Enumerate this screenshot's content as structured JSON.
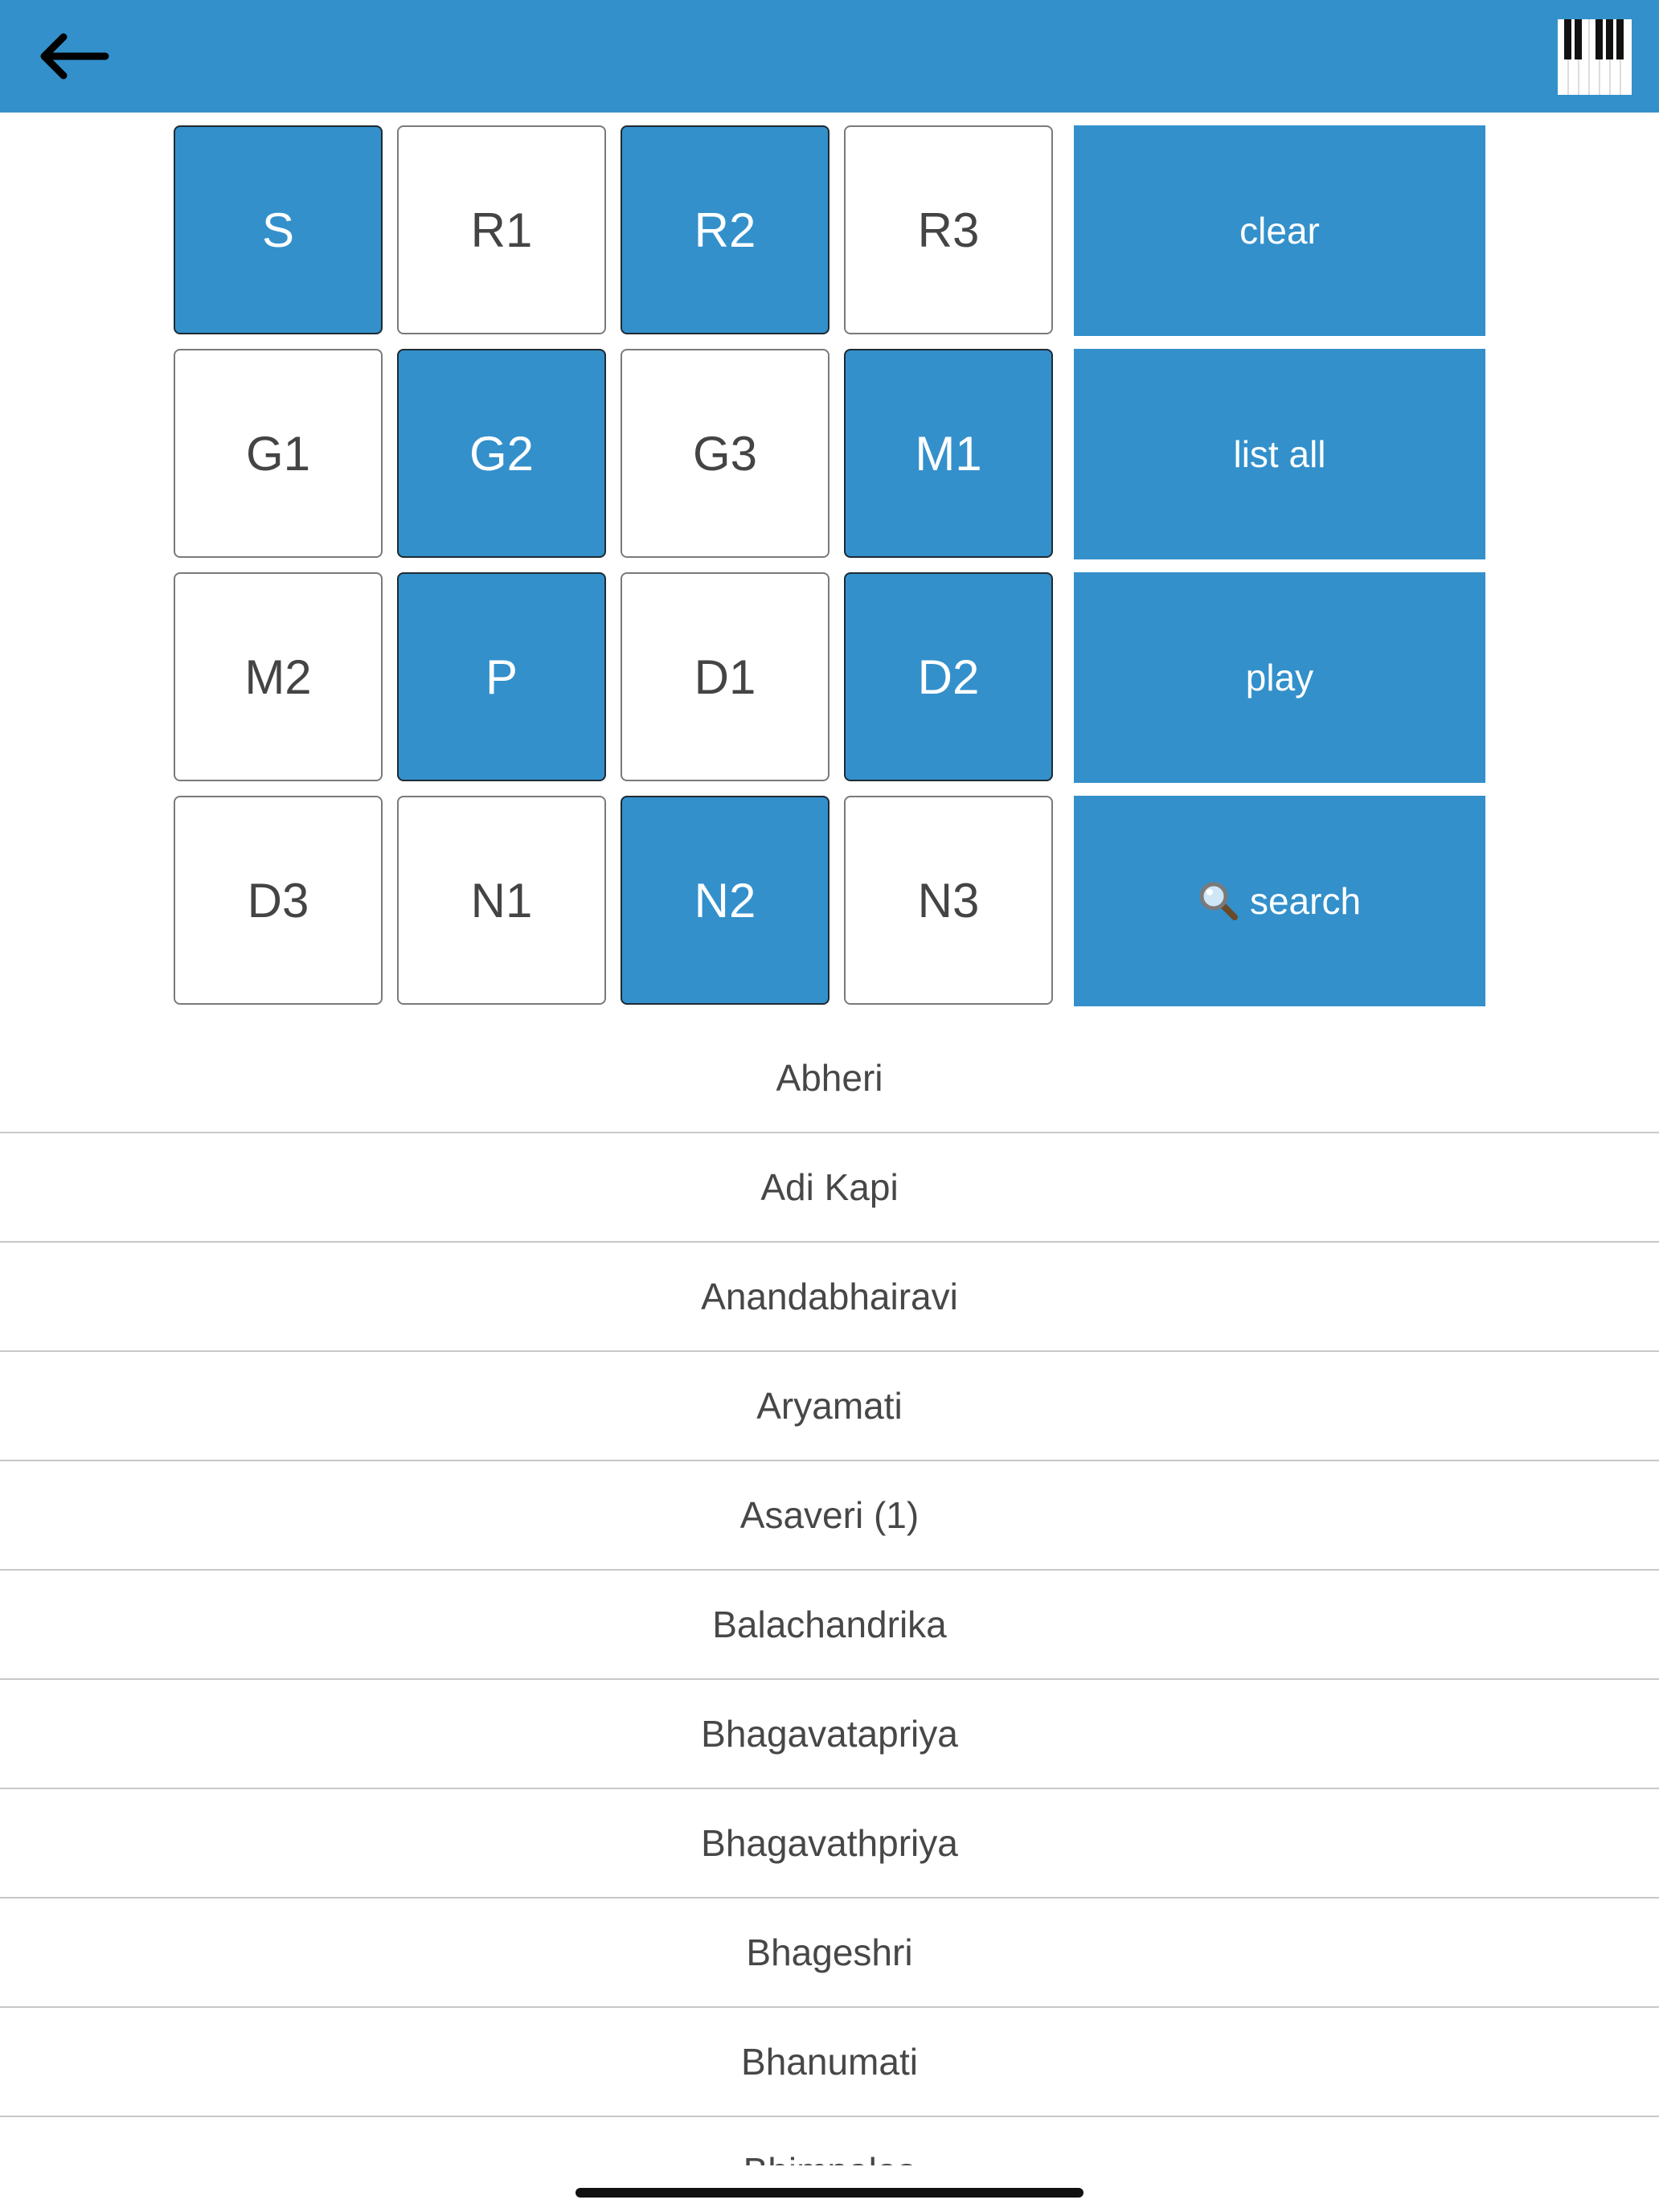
{
  "header": {
    "back_icon": "arrow-left-icon",
    "piano_icon": "piano-keys-icon",
    "bar_color": "#3390cb"
  },
  "swaras": [
    {
      "label": "S",
      "selected": true
    },
    {
      "label": "R1",
      "selected": false
    },
    {
      "label": "R2",
      "selected": true
    },
    {
      "label": "R3",
      "selected": false
    },
    {
      "label": "G1",
      "selected": false
    },
    {
      "label": "G2",
      "selected": true
    },
    {
      "label": "G3",
      "selected": false
    },
    {
      "label": "M1",
      "selected": true
    },
    {
      "label": "M2",
      "selected": false
    },
    {
      "label": "P",
      "selected": true
    },
    {
      "label": "D1",
      "selected": false
    },
    {
      "label": "D2",
      "selected": true
    },
    {
      "label": "D3",
      "selected": false
    },
    {
      "label": "N1",
      "selected": false
    },
    {
      "label": "N2",
      "selected": true
    },
    {
      "label": "N3",
      "selected": false
    }
  ],
  "actions": {
    "clear": "clear",
    "list_all": "list all",
    "play": "play",
    "search": "search",
    "search_icon": "magnifier-icon"
  },
  "ragas": [
    "Abheri",
    "Adi Kapi",
    "Anandabhairavi",
    "Aryamati",
    "Asaveri (1)",
    "Balachandrika",
    "Bhagavatapriya",
    "Bhagavathpriya",
    "Bhageshri",
    "Bhanumati",
    "Bhimpalas"
  ],
  "colors": {
    "accent": "#3390cb",
    "text": "#444444",
    "divider": "#c8c8c8"
  }
}
